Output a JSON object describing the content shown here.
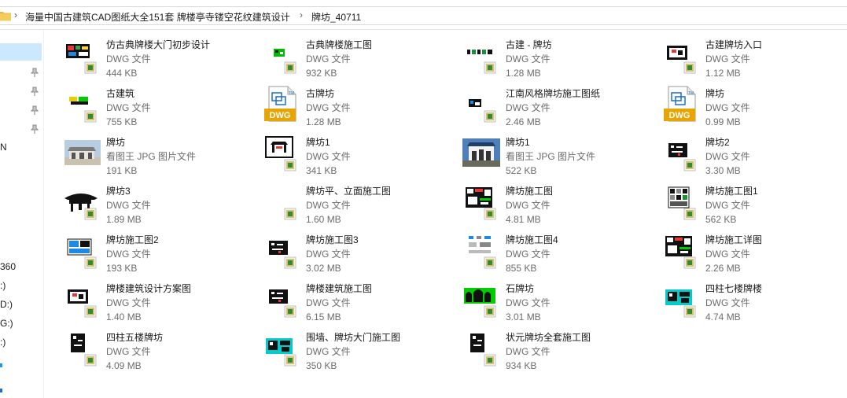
{
  "address": {
    "crumbs": [
      "海量中国古建筑CAD图纸大全151套 牌楼亭寺镂空花纹建筑设计",
      "牌坊_40711"
    ]
  },
  "nav": {
    "labels": [
      "N",
      "360",
      ":)",
      "D:)",
      "G:)",
      ":)"
    ]
  },
  "files": [
    {
      "name": "仿古典牌楼大门初步设计",
      "type": "DWG 文件",
      "size": "444 KB",
      "thumb": "cad-colorful"
    },
    {
      "name": "古典牌楼施工图",
      "type": "DWG 文件",
      "size": "932 KB",
      "thumb": "cad-green"
    },
    {
      "name": "古建 - 牌坊",
      "type": "DWG 文件",
      "size": "1.28 MB",
      "thumb": "cad-strip"
    },
    {
      "name": "古建牌坊入口",
      "type": "DWG 文件",
      "size": "1.12 MB",
      "thumb": "cad-box"
    },
    {
      "name": "古建筑",
      "type": "DWG 文件",
      "size": "755 KB",
      "thumb": "cad-yellow"
    },
    {
      "name": "古牌坊",
      "type": "DWG 文件",
      "size": "1.28 MB",
      "thumb": "dwg-icon"
    },
    {
      "name": "江南风格牌坊施工图纸",
      "type": "DWG 文件",
      "size": "2.46 MB",
      "thumb": "cad-small"
    },
    {
      "name": "牌坊",
      "type": "DWG 文件",
      "size": "0.99 MB",
      "thumb": "dwg-icon"
    },
    {
      "name": "牌坊",
      "type": "看图王 JPG 图片文件",
      "size": "191 KB",
      "thumb": "photo-arch"
    },
    {
      "name": "牌坊1",
      "type": "DWG 文件",
      "size": "341 KB",
      "thumb": "cad-frame"
    },
    {
      "name": "牌坊1",
      "type": "看图王 JPG 图片文件",
      "size": "522 KB",
      "thumb": "photo-gate"
    },
    {
      "name": "牌坊2",
      "type": "DWG 文件",
      "size": "3.30 MB",
      "thumb": "cad-black"
    },
    {
      "name": "牌坊3",
      "type": "DWG 文件",
      "size": "1.89 MB",
      "thumb": "cad-roof"
    },
    {
      "name": "牌坊平、立面施工图",
      "type": "DWG 文件",
      "size": "1.60 MB",
      "thumb": "blank"
    },
    {
      "name": "牌坊施工图",
      "type": "DWG 文件",
      "size": "4.81 MB",
      "thumb": "cad-dense"
    },
    {
      "name": "牌坊施工图1",
      "type": "DWG 文件",
      "size": "562 KB",
      "thumb": "cad-grid"
    },
    {
      "name": "牌坊施工图2",
      "type": "DWG 文件",
      "size": "193 KB",
      "thumb": "cad-blue"
    },
    {
      "name": "牌坊施工图3",
      "type": "DWG 文件",
      "size": "3.02 MB",
      "thumb": "cad-black"
    },
    {
      "name": "牌坊施工图4",
      "type": "DWG 文件",
      "size": "855 KB",
      "thumb": "cad-light"
    },
    {
      "name": "牌坊施工详图",
      "type": "DWG 文件",
      "size": "2.26 MB",
      "thumb": "cad-dense"
    },
    {
      "name": "牌楼建筑设计方案图",
      "type": "DWG 文件",
      "size": "1.40 MB",
      "thumb": "cad-box"
    },
    {
      "name": "牌楼建筑施工图",
      "type": "DWG 文件",
      "size": "6.15 MB",
      "thumb": "cad-black"
    },
    {
      "name": "石牌坊",
      "type": "DWG 文件",
      "size": "3.01 MB",
      "thumb": "cad-arches"
    },
    {
      "name": "四柱七楼牌楼",
      "type": "DWG 文件",
      "size": "4.74 MB",
      "thumb": "cad-cyan"
    },
    {
      "name": "四柱五楼牌坊",
      "type": "DWG 文件",
      "size": "4.09 MB",
      "thumb": "cad-tall"
    },
    {
      "name": "围墙、牌坊大门施工图",
      "type": "DWG 文件",
      "size": "350 KB",
      "thumb": "cad-cyan"
    },
    {
      "name": "状元牌坊全套施工图",
      "type": "DWG 文件",
      "size": "934 KB",
      "thumb": "cad-tall"
    }
  ],
  "colors": {
    "selection": "#cce8ff",
    "dwg_orange": "#e8a400",
    "dwg_blue": "#1e6fc2"
  }
}
